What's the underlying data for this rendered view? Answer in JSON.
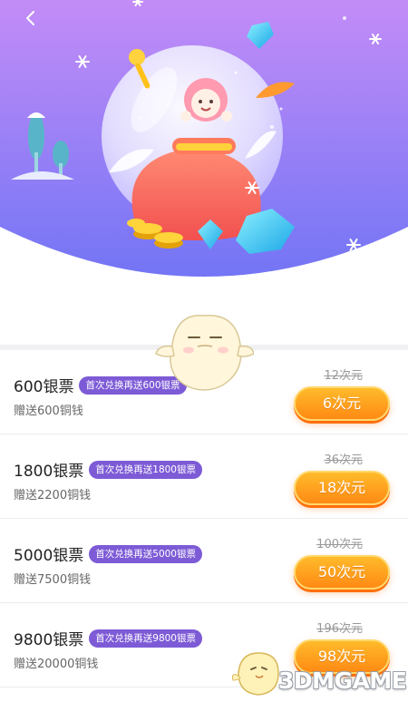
{
  "header": {
    "back_icon": "chevron-left-icon"
  },
  "colors": {
    "hero_gradient_top": "#c38cf7",
    "hero_gradient_bottom": "#6f74f5",
    "badge": "#7d5bd6",
    "button_top": "#ffbb2b",
    "button_bottom": "#ff8a14"
  },
  "packages": [
    {
      "amount": "600银票",
      "badge": "首次兑换再送600银票",
      "bonus": "赠送600铜钱",
      "original_price": "12次元",
      "price": "6次元"
    },
    {
      "amount": "1800银票",
      "badge": "首次兑换再送1800银票",
      "bonus": "赠送2200铜钱",
      "original_price": "36次元",
      "price": "18次元"
    },
    {
      "amount": "5000银票",
      "badge": "首次兑换再送5000银票",
      "bonus": "赠送7500铜钱",
      "original_price": "100次元",
      "price": "50次元"
    },
    {
      "amount": "9800银票",
      "badge": "首次兑换再送9800银票",
      "bonus": "赠送20000铜钱",
      "original_price": "196次元",
      "price": "98次元"
    }
  ],
  "watermark": {
    "text": "3DMGAME"
  }
}
